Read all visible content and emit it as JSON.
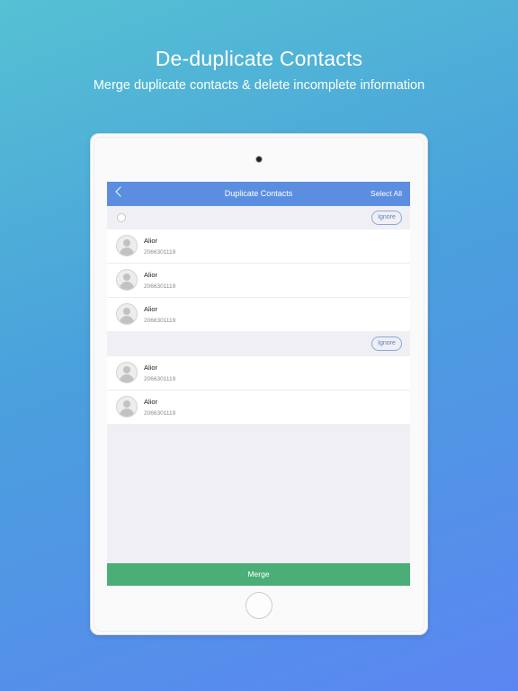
{
  "headline": "De-duplicate Contacts",
  "subline": "Merge duplicate contacts & delete incomplete information",
  "navbar": {
    "title": "Duplicate Contacts",
    "select_all": "Select All"
  },
  "groups": [
    {
      "ignore_label": "Ignore",
      "contacts": [
        {
          "name": "Alior",
          "phone": "2066301119"
        },
        {
          "name": "Alior",
          "phone": "2066301119"
        },
        {
          "name": "Alior",
          "phone": "2066301119"
        }
      ]
    },
    {
      "ignore_label": "Ignore",
      "contacts": [
        {
          "name": "Alior",
          "phone": "2066301119"
        },
        {
          "name": "Alior",
          "phone": "2066301119"
        }
      ]
    }
  ],
  "merge_label": "Merge"
}
